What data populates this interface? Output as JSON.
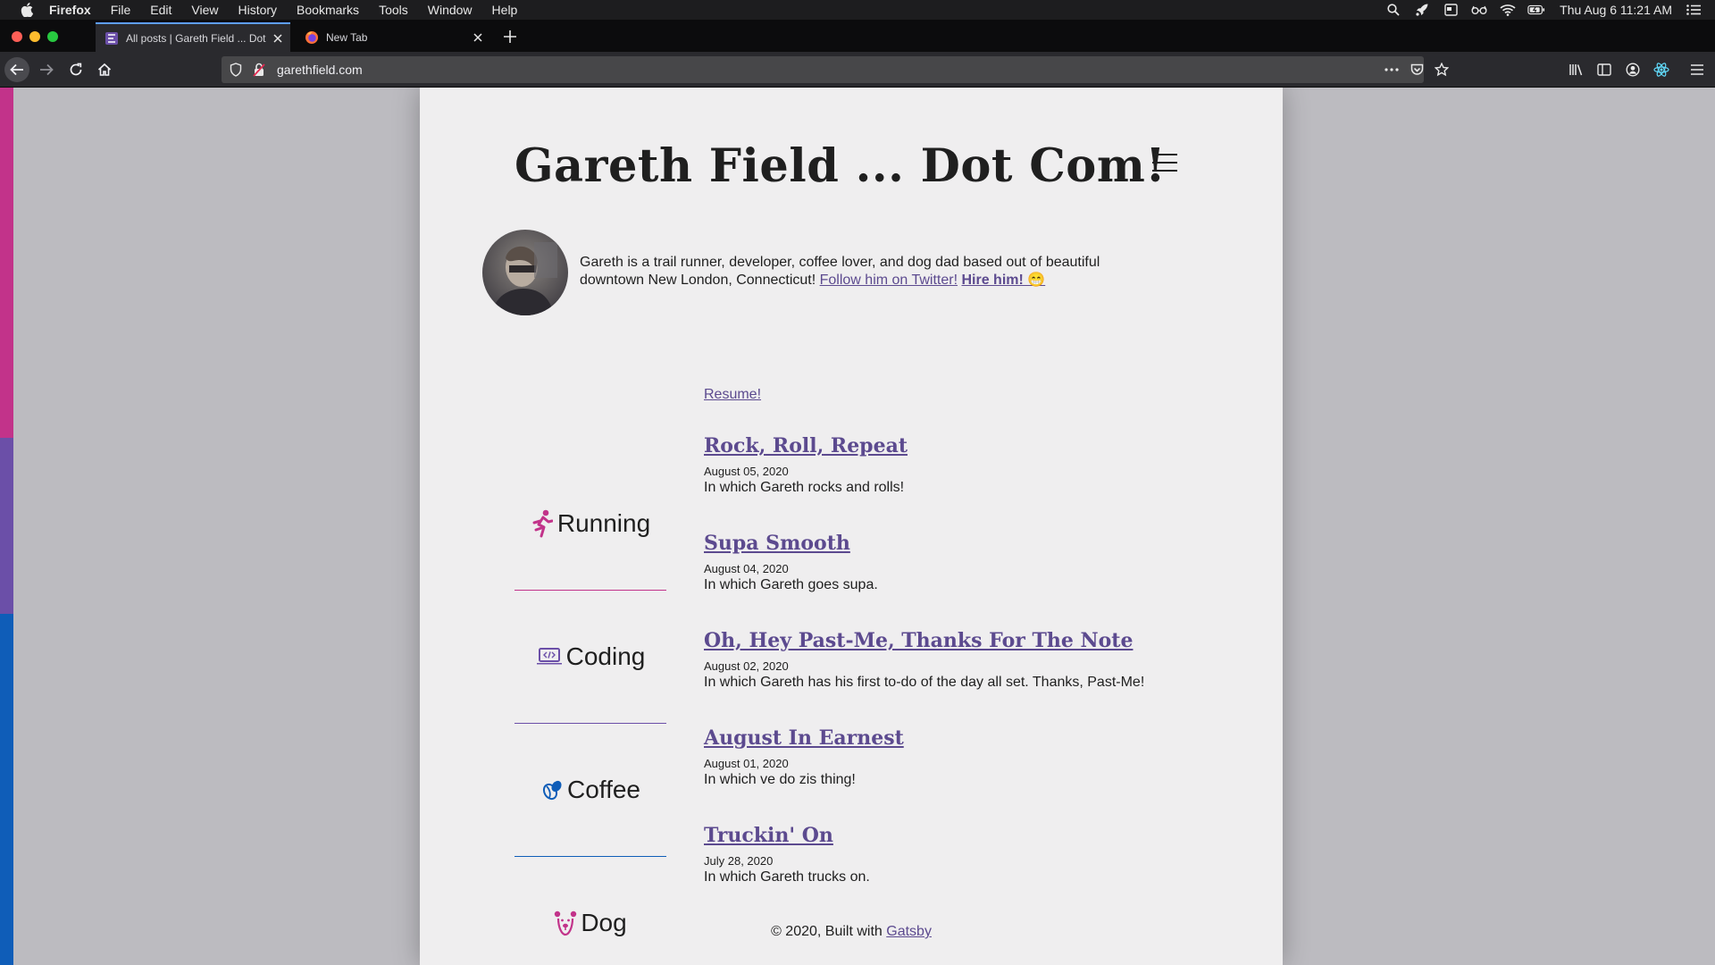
{
  "menubar": {
    "items": [
      "Firefox",
      "File",
      "Edit",
      "View",
      "History",
      "Bookmarks",
      "Tools",
      "Window",
      "Help"
    ],
    "clock": "Thu Aug 6  11:21 AM"
  },
  "tabs": [
    {
      "title": "All posts | Gareth Field ... Dot C",
      "active": true
    },
    {
      "title": "New Tab",
      "active": false
    }
  ],
  "urlbar": {
    "url": "garethfield.com"
  },
  "site": {
    "title": "Gareth Field ... Dot Com!",
    "bio_text": "Gareth is a trail runner, developer, coffee lover, and dog dad based out of beautiful downtown New London, Connecticut! ",
    "twitter_link": "Follow him on Twitter!",
    "hire_link": "Hire him! 😁",
    "resume_link": "Resume!"
  },
  "interests": [
    {
      "label": "Running",
      "icon": "running-person-icon",
      "color": "#c2338a"
    },
    {
      "label": "Coding",
      "icon": "laptop-code-icon",
      "color": "#6b4fa8"
    },
    {
      "label": "Coffee",
      "icon": "coffee-beans-icon",
      "color": "#0f5db8"
    },
    {
      "label": "Dog",
      "icon": "dog-face-icon",
      "color": "#c2338a"
    }
  ],
  "posts": [
    {
      "title": "Rock, Roll, Repeat",
      "date": "August 05, 2020",
      "description": "In which Gareth rocks and rolls!"
    },
    {
      "title": "Supa Smooth",
      "date": "August 04, 2020",
      "description": "In which Gareth goes supa."
    },
    {
      "title": "Oh, Hey Past-Me, Thanks For The Note",
      "date": "August 02, 2020",
      "description": "In which Gareth has his first to-do of the day all set. Thanks, Past-Me!"
    },
    {
      "title": "August In Earnest",
      "date": "August 01, 2020",
      "description": "In which ve do zis thing!"
    },
    {
      "title": "Truckin' On",
      "date": "July 28, 2020",
      "description": "In which Gareth trucks on."
    }
  ],
  "footer": {
    "text": "© 2020, Built with ",
    "link": "Gatsby"
  },
  "colors": {
    "link": "#5c4a8f",
    "pink": "#c2338a",
    "purple": "#6b4fa8",
    "blue": "#0f5db8",
    "page_bg": "#efeeef",
    "backdrop": "#bcbbc0"
  }
}
